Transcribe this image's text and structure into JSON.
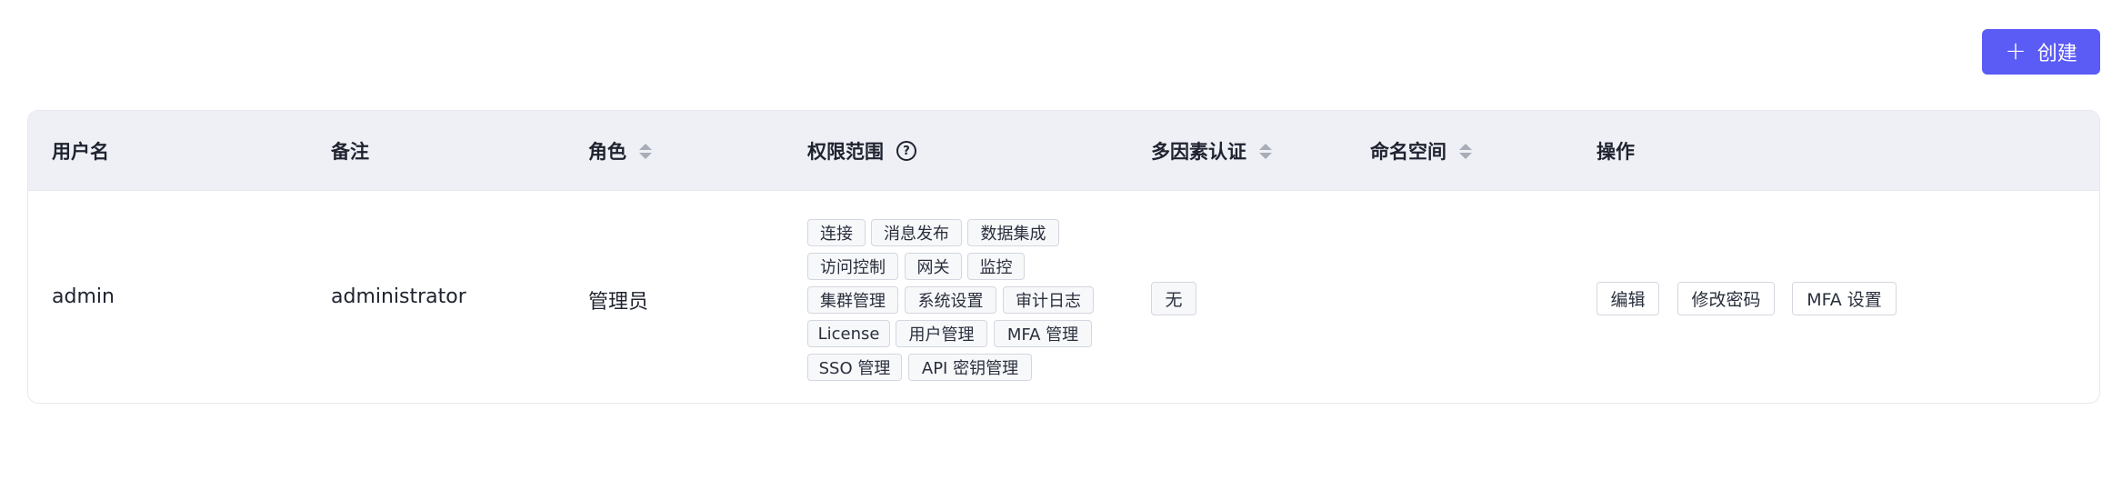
{
  "toolbar": {
    "create_label": "创建"
  },
  "table": {
    "columns": {
      "username": "用户名",
      "remark": "备注",
      "role": "角色",
      "scope": "权限范围",
      "mfa": "多因素认证",
      "namespace": "命名空间",
      "actions": "操作"
    },
    "row": {
      "username": "admin",
      "remark": "administrator",
      "role": "管理员",
      "scope_tags": [
        "连接",
        "消息发布",
        "数据集成",
        "访问控制",
        "网关",
        "监控",
        "集群管理",
        "系统设置",
        "审计日志",
        "License",
        "用户管理",
        "MFA 管理",
        "SSO 管理",
        "API 密钥管理"
      ],
      "mfa": "无",
      "actions": {
        "edit": "编辑",
        "change_password": "修改密码",
        "mfa_settings": "MFA 设置"
      }
    }
  },
  "colors": {
    "accent": "#5b5bf6",
    "header_bg": "#eef0f5"
  },
  "icons": [
    "plus-icon",
    "sort-icon",
    "help-icon"
  ]
}
